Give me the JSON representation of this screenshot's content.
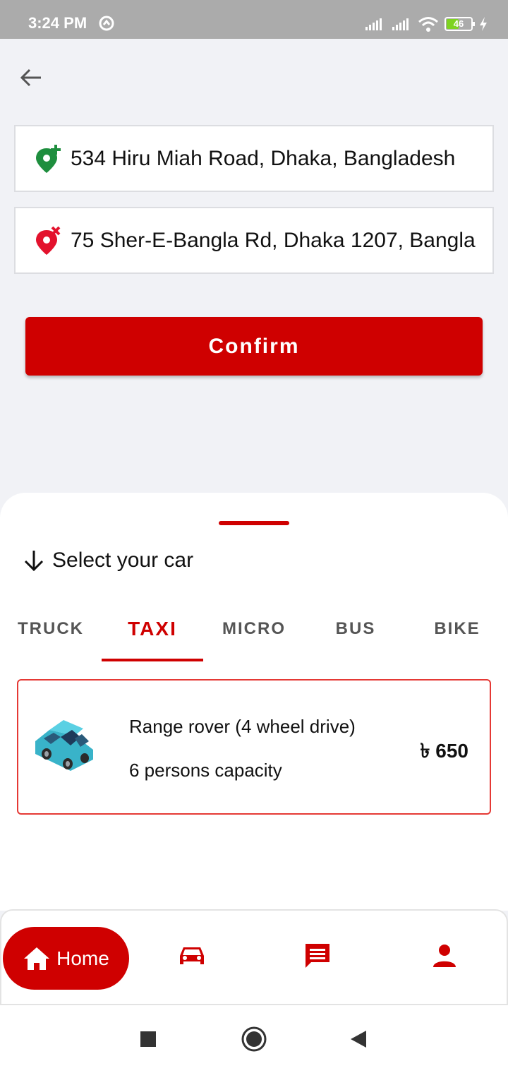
{
  "status_bar": {
    "time": "3:24 PM",
    "battery_level": "46"
  },
  "header": {
    "back_icon": "arrow-left-icon"
  },
  "route": {
    "pickup_address": "534 Hiru Miah Road, Dhaka, Bangladesh",
    "dropoff_address": "75 Sher-E-Bangla Rd, Dhaka 1207, Bangla",
    "pickup_icon": "location-add-icon",
    "dropoff_icon": "location-remove-icon"
  },
  "confirm": {
    "label": "Confirm"
  },
  "sheet": {
    "title": "Select your car",
    "tabs": [
      {
        "label": "TRUCK"
      },
      {
        "label": "TAXI"
      },
      {
        "label": "MICRO"
      },
      {
        "label": "BUS"
      },
      {
        "label": "BIKE"
      }
    ],
    "active_tab": "TAXI",
    "car": {
      "name": "Range rover (4 wheel drive)",
      "capacity": "6 persons capacity",
      "price": "৳ 650"
    }
  },
  "bottom_nav": {
    "home_label": "Home",
    "items": [
      "home-icon",
      "car-icon",
      "chat-icon",
      "person-icon"
    ]
  },
  "colors": {
    "accent": "#cf0000",
    "pickup_green": "#1e8e3e",
    "background": "#f1f2f6"
  }
}
